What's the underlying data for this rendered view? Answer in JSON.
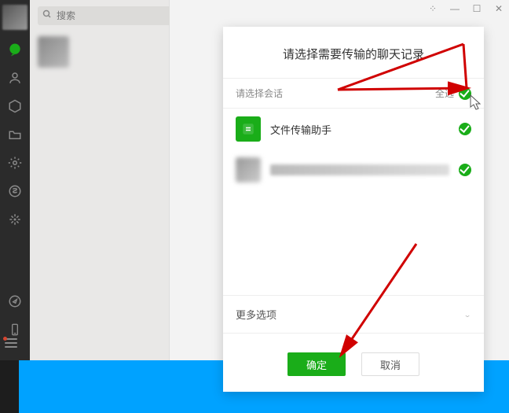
{
  "window_controls": {
    "pin": "⏷",
    "min": "—",
    "max": "☐",
    "close": "✕"
  },
  "search": {
    "placeholder": "搜索"
  },
  "sidebar": {
    "icons": [
      "chat",
      "contacts",
      "favorites",
      "files",
      "settings",
      "programs",
      "moments"
    ],
    "bottom_icons": [
      "discover",
      "phone",
      "menu"
    ]
  },
  "modal": {
    "title": "请选择需要传输的聊天记录",
    "section_label": "请选择会话",
    "select_all_label": "全选",
    "conversations": [
      {
        "name": "文件传输助手",
        "checked": true,
        "icon": "file-transfer"
      },
      {
        "name": "",
        "checked": true,
        "icon": "blurred"
      }
    ],
    "more_options_label": "更多选项",
    "confirm_label": "确定",
    "cancel_label": "取消"
  },
  "colors": {
    "accent": "#1aad19",
    "blue_strip": "#00a2ff"
  }
}
